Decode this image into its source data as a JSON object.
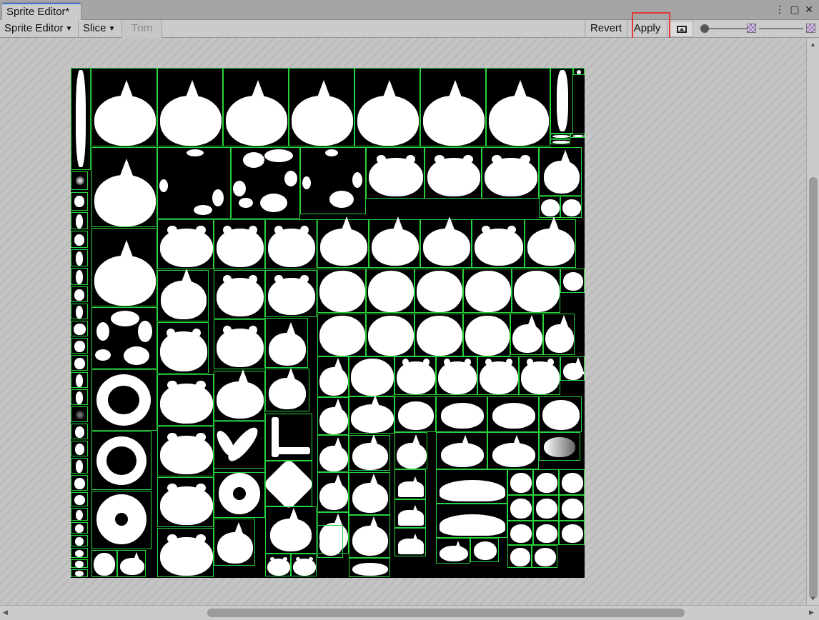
{
  "window": {
    "tab_title": "Sprite Editor*"
  },
  "toolbar": {
    "mode_label": "Sprite Editor",
    "slice_label": "Slice",
    "trim_label": "Trim",
    "revert_label": "Revert",
    "apply_label": "Apply"
  },
  "icons": {
    "tab_menu": "kebab-menu-icon",
    "maximize": "maximize-icon",
    "close": "close-icon",
    "texture_toggle": "image-icon",
    "zoom_slider": "slider-icon",
    "alpha_checker": "checker-icon"
  },
  "colors": {
    "sprite_outline": "#27d33a",
    "highlight": "#e33b3b",
    "tab_accent": "#3a79d7"
  },
  "sprite_sheet": {
    "description_visible": false,
    "outline_count_estimate": 150
  },
  "zoom": {
    "level_fraction": 0.0,
    "mip_fraction": 1.0
  }
}
